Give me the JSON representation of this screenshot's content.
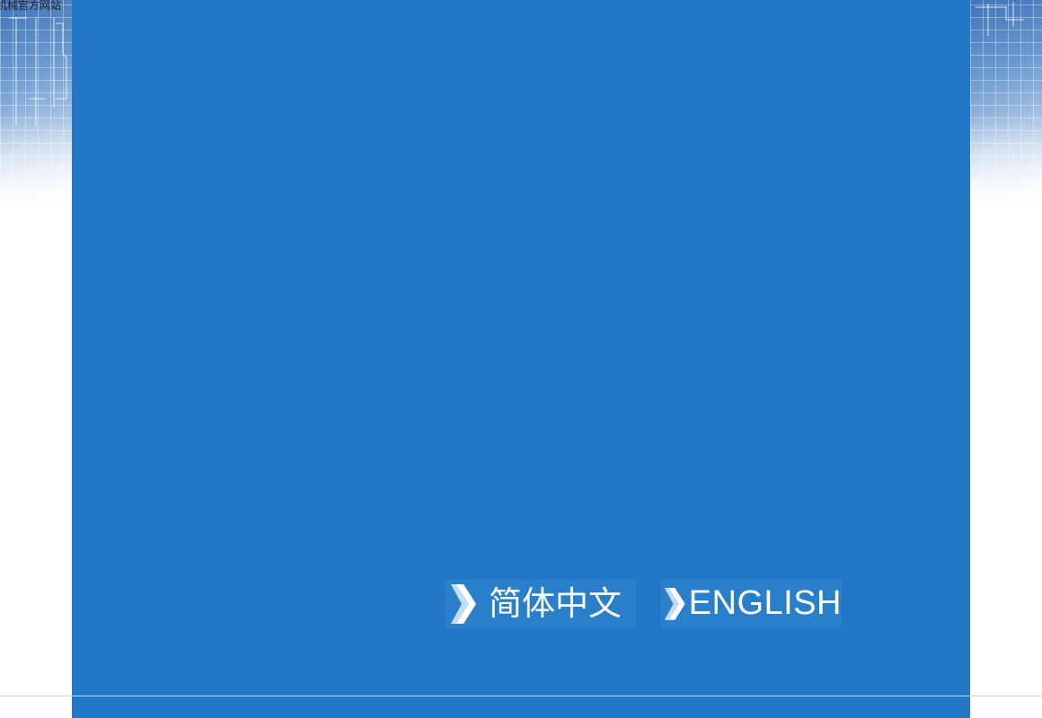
{
  "site_title": "机械官方网站",
  "languages": [
    {
      "label": "简体中文"
    },
    {
      "label": "ENGLISH"
    }
  ],
  "colors": {
    "panel": "#2278c7",
    "button": "#2a7fca",
    "text": "#ffffff"
  },
  "icons": {
    "language_arrow": "chevron-right-icon"
  }
}
